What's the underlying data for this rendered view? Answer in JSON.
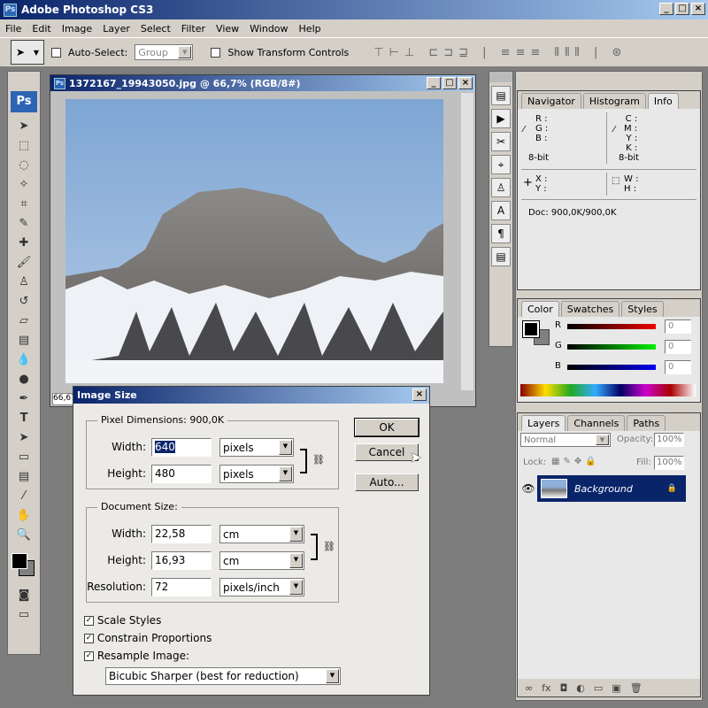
{
  "app": {
    "title": "Adobe Photoshop CS3",
    "icon_label": "Ps"
  },
  "menu": [
    "File",
    "Edit",
    "Image",
    "Layer",
    "Select",
    "Filter",
    "View",
    "Window",
    "Help"
  ],
  "options": {
    "auto_select_label": "Auto-Select:",
    "auto_select_checked": false,
    "group_value": "Group",
    "transform_label": "Show Transform Controls",
    "transform_checked": false
  },
  "tools": {
    "logo": "Ps",
    "icons": [
      "move-icon",
      "marquee-icon",
      "lasso-icon",
      "magic-wand-icon",
      "crop-icon",
      "slice-icon",
      "healing-icon",
      "brush-icon",
      "stamp-icon",
      "history-brush-icon",
      "eraser-icon",
      "gradient-icon",
      "blur-icon",
      "dodge-icon",
      "pen-icon",
      "type-icon",
      "path-select-icon",
      "shape-icon",
      "notes-icon",
      "eyedropper-icon",
      "hand-icon",
      "zoom-icon"
    ],
    "type_glyph": "T"
  },
  "document": {
    "title": "1372167_19943050.jpg @ 66,7% (RGB/8#)",
    "zoom_field": "66,67"
  },
  "dialog": {
    "title": "Image Size",
    "pixel_dimensions_label": "Pixel Dimensions:",
    "pixel_dimensions_value": "900,0K",
    "pixel_width_label": "Width:",
    "pixel_width": "640",
    "pixel_width_unit": "pixels",
    "pixel_height_label": "Height:",
    "pixel_height": "480",
    "pixel_height_unit": "pixels",
    "document_size_label": "Document Size:",
    "doc_width_label": "Width:",
    "doc_width": "22,58",
    "doc_width_unit": "cm",
    "doc_height_label": "Height:",
    "doc_height": "16,93",
    "doc_height_unit": "cm",
    "resolution_label": "Resolution:",
    "resolution": "72",
    "resolution_unit": "pixels/inch",
    "scale_styles": "Scale Styles",
    "constrain": "Constrain Proportions",
    "resample": "Resample Image:",
    "resample_method": "Bicubic Sharper (best for reduction)",
    "ok": "OK",
    "cancel": "Cancel",
    "auto": "Auto..."
  },
  "info_panel": {
    "tabs": [
      "Navigator",
      "Histogram",
      "Info"
    ],
    "active": "Info",
    "r": "R :",
    "g": "G :",
    "b": "B :",
    "c": "C :",
    "m": "M :",
    "y": "Y :",
    "k": "K :",
    "bit1": "8-bit",
    "bit2": "8-bit",
    "x": "X :",
    "yy": "Y :",
    "w": "W :",
    "h": "H :",
    "doc": "Doc: 900,0K/900,0K"
  },
  "color_panel": {
    "tabs": [
      "Color",
      "Swatches",
      "Styles"
    ],
    "r_label": "R",
    "g_label": "G",
    "b_label": "B",
    "r": "0",
    "g": "0",
    "b": "0",
    "foreground": "#000000",
    "background": "#808080"
  },
  "layers_panel": {
    "tabs": [
      "Layers",
      "Channels",
      "Paths"
    ],
    "blend_mode": "Normal",
    "opacity_label": "Opacity:",
    "opacity": "100%",
    "lock_label": "Lock:",
    "fill_label": "Fill:",
    "fill": "100%",
    "layers": [
      {
        "name": "Background",
        "visible": true,
        "locked": true,
        "selected": true
      }
    ]
  },
  "colors": {
    "title_start": "#0a246a",
    "title_end": "#a6caf0",
    "selected_layer": "#0a246a"
  }
}
